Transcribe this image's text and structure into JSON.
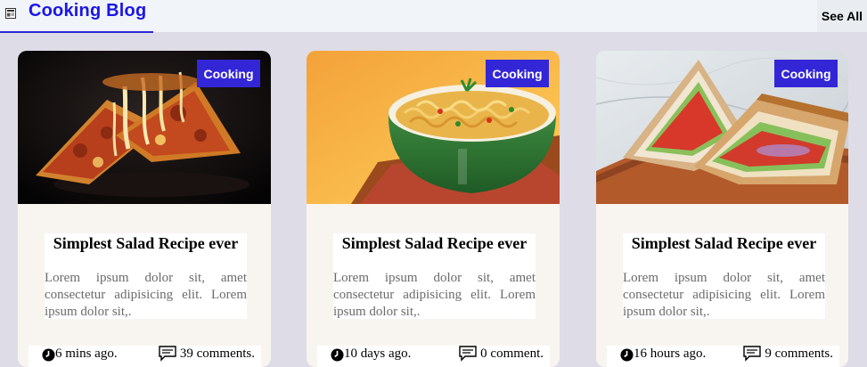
{
  "header": {
    "brand_icon": "blog-icon",
    "title": "Cooking Blog",
    "see_all_label": "See All"
  },
  "cards": [
    {
      "image": "pizza-photo",
      "tag": "Cooking",
      "title": "Simplest Salad Recipe ever",
      "description": "Lorem ipsum dolor sit, amet consectetur adipisicing elit. Lorem ipsum dolor sit,.",
      "time": "6 mins ago.",
      "comments": "39 comments."
    },
    {
      "image": "noodles-photo",
      "tag": "Cooking",
      "title": "Simplest Salad Recipe ever",
      "description": "Lorem ipsum dolor sit, amet consectetur adipisicing elit. Lorem ipsum dolor sit,.",
      "time": "10 days ago.",
      "comments": "0 comment."
    },
    {
      "image": "sandwich-photo",
      "tag": "Cooking",
      "title": "Simplest Salad Recipe ever",
      "description": "Lorem ipsum dolor sit, amet consectetur adipisicing elit. Lorem ipsum dolor sit,.",
      "time": "16 hours ago.",
      "comments": "9 comments."
    }
  ],
  "colors": {
    "accent": "#3326d6",
    "brand_text": "#1b15e6",
    "page_bg": "#dedce6",
    "card_bg": "#f8f5f0"
  }
}
